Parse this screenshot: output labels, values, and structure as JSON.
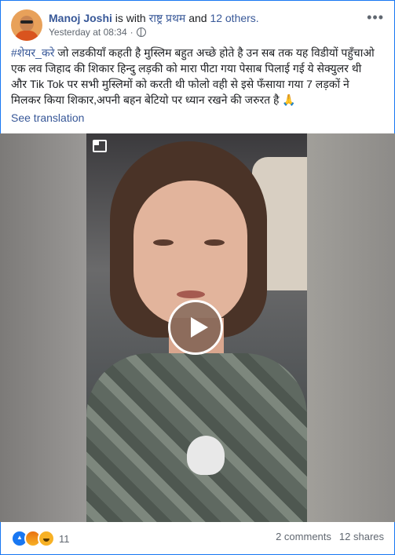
{
  "post": {
    "author": "Manoj Joshi",
    "with_text": "is with",
    "tagged_page": "राष्ट्र प्रथम",
    "and_text": "and",
    "others": "12 others.",
    "timestamp": "Yesterday at 08:34",
    "privacy_icon": "globe-icon",
    "more_icon": "more-options-icon",
    "hashtag": "#शेयर_करे",
    "body": " जो लडकीयाँ कहती है मुस्लिम बहुत अच्छे होते है उन सब तक यह विडीयों पहुँचाओ एक लव जिहाद की शिकार हिन्दु लड़की को मारा पीटा गया पेसाब पिलाई गई ये सेक्युलर थी और Tik Tok पर सभी मुस्लिमों को करती थी फोलो वही से इसे फँसाया गया 7 लड़कों ने मिलकर किया शिकार,अपनी बहन बेटियो पर ध्यान रखने की जरुरत है 🙏",
    "see_translation": "See translation"
  },
  "video": {
    "play_icon": "play-icon",
    "pip_icon": "picture-in-picture-icon"
  },
  "footer": {
    "reaction_icons": [
      "like-icon",
      "angry-icon",
      "haha-icon"
    ],
    "reaction_count": "11",
    "comments": "2 comments",
    "shares": "12 shares"
  },
  "colors": {
    "link": "#385898",
    "frame_border": "#1877f2",
    "meta_text": "#606770"
  }
}
